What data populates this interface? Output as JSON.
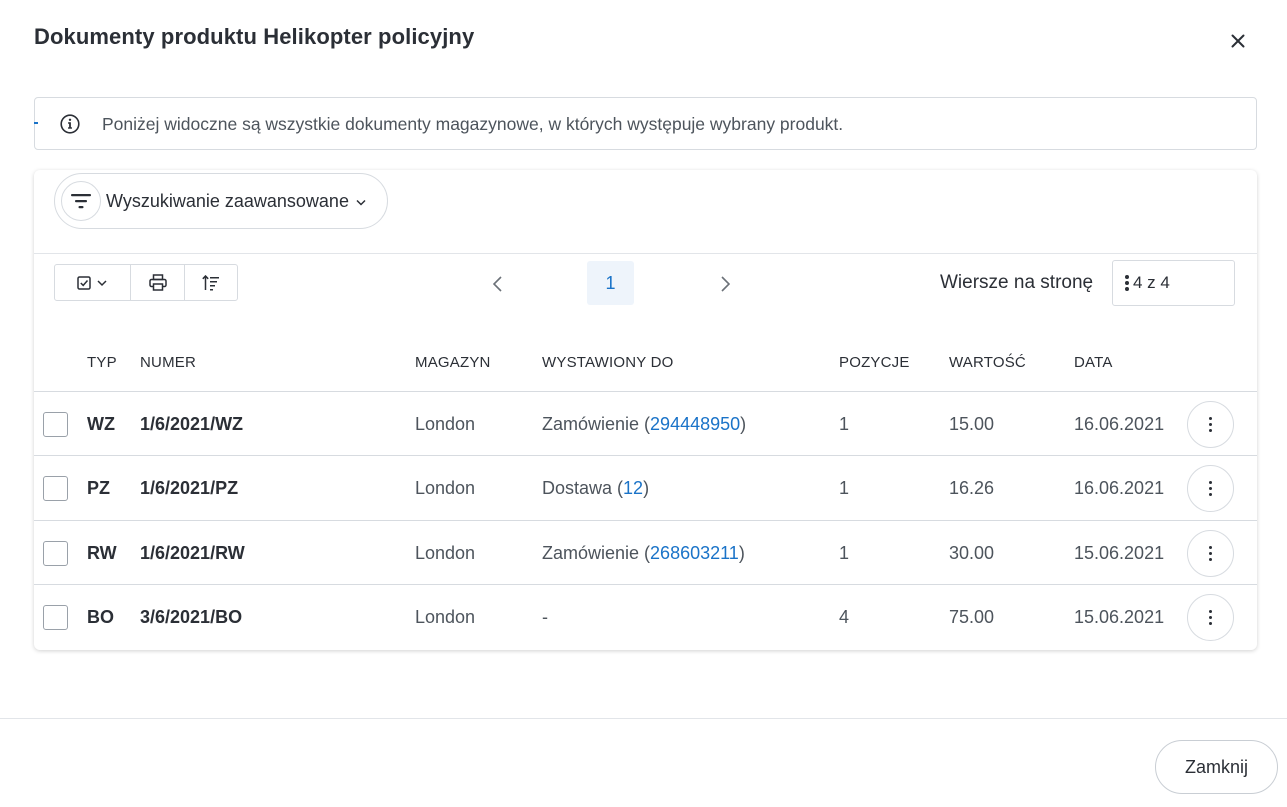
{
  "modal": {
    "title": "Dokumenty produktu Helikopter policyjny",
    "close_icon": "close-icon"
  },
  "info": {
    "icon": "info-icon",
    "text": "Poniżej widoczne są wszystkie dokumenty magazynowe, w których występuje wybrany produkt."
  },
  "search": {
    "advanced_label": "Wyszukiwanie zaawansowane",
    "filter_icon": "filter-icon",
    "chevron_icon": "chevron-down-icon"
  },
  "toolbar": {
    "select_icon": "checkbox-select-icon",
    "print_icon": "print-icon",
    "sort_icon": "sort-icon"
  },
  "pagination": {
    "prev_icon": "chevron-left-icon",
    "current_page": "1",
    "next_icon": "chevron-right-icon",
    "rows_label": "Wiersze na stronę",
    "rows_value": "4 z 4"
  },
  "table": {
    "columns": [
      "TYP",
      "NUMER",
      "MAGAZYN",
      "WYSTAWIONY DO",
      "POZYCJE",
      "WARTOŚĆ",
      "DATA"
    ],
    "rows": [
      {
        "type": "WZ",
        "number": "1/6/2021/WZ",
        "warehouse": "London",
        "issued_prefix": "Zamówienie (",
        "issued_link": "294448950",
        "issued_suffix": ")",
        "positions": "1",
        "value": "15.00",
        "date": "16.06.2021"
      },
      {
        "type": "PZ",
        "number": "1/6/2021/PZ",
        "warehouse": "London",
        "issued_prefix": "Dostawa (",
        "issued_link": "12",
        "issued_suffix": ")",
        "positions": "1",
        "value": "16.26",
        "date": "16.06.2021"
      },
      {
        "type": "RW",
        "number": "1/6/2021/RW",
        "warehouse": "London",
        "issued_prefix": "Zamówienie (",
        "issued_link": "268603211",
        "issued_suffix": ")",
        "positions": "1",
        "value": "30.00",
        "date": "15.06.2021"
      },
      {
        "type": "BO",
        "number": "3/6/2021/BO",
        "warehouse": "London",
        "issued_prefix": "-",
        "issued_link": "",
        "issued_suffix": "",
        "positions": "4",
        "value": "75.00",
        "date": "15.06.2021"
      }
    ]
  },
  "footer": {
    "close_label": "Zamknij"
  },
  "colors": {
    "accent": "#1a73c8",
    "text": "#2b2f36",
    "muted": "#4d545c",
    "border": "#d7dbe0"
  }
}
